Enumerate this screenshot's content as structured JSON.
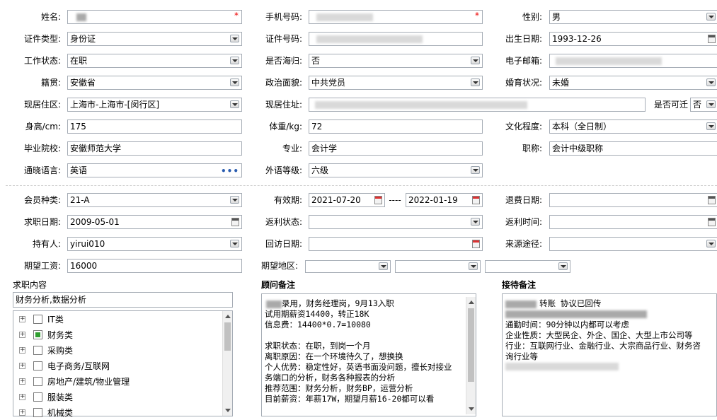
{
  "personal": {
    "name_label": "姓名:",
    "phone_label": "手机号码:",
    "gender_label": "性别:",
    "gender_value": "男",
    "id_type_label": "证件类型:",
    "id_type_value": "身份证",
    "id_no_label": "证件号码:",
    "birth_label": "出生日期:",
    "birth_value": "1993-12-26",
    "work_status_label": "工作状态:",
    "work_status_value": "在职",
    "returnee_label": "是否海归:",
    "returnee_value": "否",
    "email_label": "电子邮箱:",
    "native_label": "籍贯:",
    "native_value": "安徽省",
    "political_label": "政治面貌:",
    "political_value": "中共党员",
    "marital_label": "婚育状况:",
    "marital_value": "未婚",
    "residence_area_label": "现居住区:",
    "residence_area_value": "上海市-上海市-[闵行区]",
    "address_label": "现居住址:",
    "relocate_label": "是否可迁",
    "relocate_value": "否",
    "height_label": "身高/cm:",
    "height_value": "175",
    "weight_label": "体重/kg:",
    "weight_value": "72",
    "education_label": "文化程度:",
    "education_value": "本科（全日制）",
    "school_label": "毕业院校:",
    "school_value": "安徽师范大学",
    "major_label": "专业:",
    "major_value": "会计学",
    "title_label": "职称:",
    "title_value": "会计中级职称",
    "language_label": "通晓语言:",
    "language_value": "英语",
    "lang_level_label": "外语等级:",
    "lang_level_value": "六级"
  },
  "membership": {
    "type_label": "会员种类:",
    "type_value": "21-A",
    "valid_label": "有效期:",
    "valid_from": "2021-07-20",
    "valid_sep": "----",
    "valid_to": "2022-01-19",
    "refund_date_label": "退费日期:",
    "job_date_label": "求职日期:",
    "job_date_value": "2009-05-01",
    "rebate_status_label": "返利状态:",
    "rebate_time_label": "返利时间:",
    "holder_label": "持有人:",
    "holder_value": "yirui010",
    "visit_date_label": "回访日期:",
    "source_label": "来源途径:",
    "salary_label": "期望工资:",
    "salary_value": "16000",
    "region_label": "期望地区:"
  },
  "job_content": {
    "title": "求职内容",
    "summary": "财务分析,数据分析",
    "tree": [
      {
        "label": "IT类",
        "checked": false
      },
      {
        "label": "财务类",
        "checked": true
      },
      {
        "label": "采购类",
        "checked": false
      },
      {
        "label": "电子商务/互联网",
        "checked": false
      },
      {
        "label": "房地产/建筑/物业管理",
        "checked": false
      },
      {
        "label": "服装类",
        "checked": false
      },
      {
        "label": "机械类",
        "checked": false
      }
    ]
  },
  "consultant_notes": {
    "title": "顾问备注",
    "lines": [
      "录用，财务经理岗，9月13入职",
      "试用期薪资14400，转正18K",
      "信息费：14400*0.7=10080",
      "",
      "求职状态：在职，到岗一个月",
      "离职原因：在一个环境待久了，想换换",
      "个人优势：稳定性好，英语书面没问题，擅长对接业",
      "务端口的分析，财务各种报表的分析",
      "推荐范围：财务分析，财务BP，运营分析",
      "目前薪资：年薪17W，期望月薪16-20都可以看"
    ]
  },
  "reception_notes": {
    "title": "接待备注",
    "line1": "转账 协议已回传",
    "lines": [
      "通勤时间：90分钟以内都可以考虑",
      "企业性质：大型民企、外企、国企、大型上市公司等",
      "行业：互联网行业、金融行业、大宗商品行业、财务咨",
      "询行业等"
    ]
  },
  "colors": {
    "required": "#e00000",
    "border": "#a5acb5",
    "checked": "#2f9e2f"
  }
}
